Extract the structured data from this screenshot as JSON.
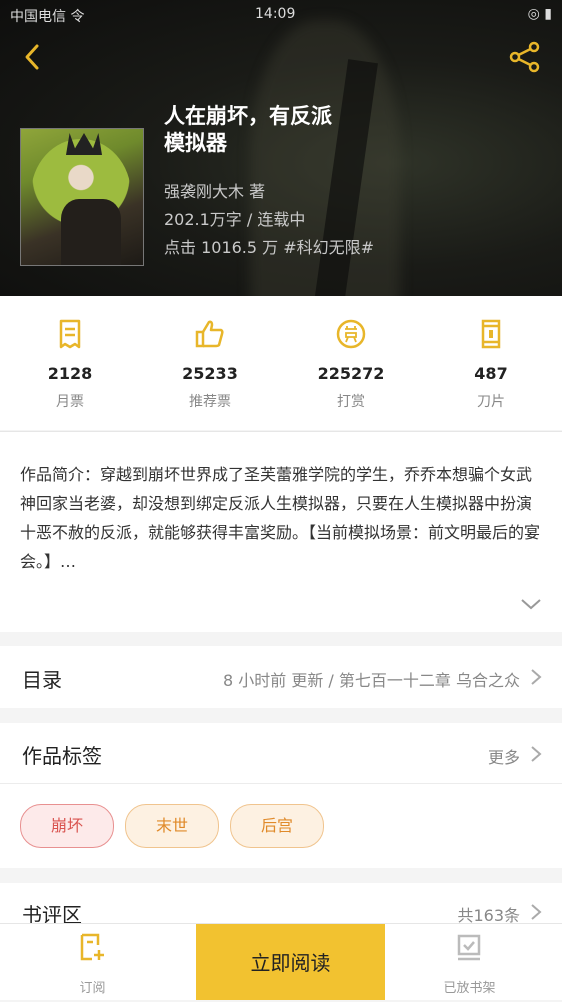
{
  "status_bar": {
    "carrier": "中国电信 令",
    "time": "14:09",
    "battery": "◎ ▮"
  },
  "book": {
    "title_line1": "人在崩坏，有反派",
    "title_line2": "模拟器",
    "author_line": "强袭刚大木  著",
    "words_line": "202.1万字 / 连载中",
    "clicks_line": "点击 1016.5 万  #科幻无限#"
  },
  "stats": [
    {
      "icon": "monthly-ticket-icon",
      "value": "2128",
      "label": "月票"
    },
    {
      "icon": "thumbs-up-icon",
      "value": "25233",
      "label": "推荐票"
    },
    {
      "icon": "reward-icon",
      "value": "225272",
      "label": "打赏"
    },
    {
      "icon": "blade-icon",
      "value": "487",
      "label": "刀片"
    }
  ],
  "intro": {
    "text": "作品简介：穿越到崩坏世界成了圣芙蕾雅学院的学生，乔乔本想骗个女武神回家当老婆，却没想到绑定反派人生模拟器，只要在人生模拟器中扮演十恶不赦的反派，就能够获得丰富奖励。【当前模拟场景：前文明最后的宴会。】…"
  },
  "toc": {
    "label": "目录",
    "update": "8 小时前 更新 / 第七百一十二章 乌合之众"
  },
  "tags_section": {
    "label": "作品标签",
    "more": "更多",
    "tags": [
      "崩坏",
      "末世",
      "后宫"
    ]
  },
  "reviews": {
    "label": "书评区",
    "count": "共163条"
  },
  "bottom_bar": {
    "subscribe": "订阅",
    "read_now": "立即阅读",
    "shelved": "已放书架"
  },
  "colors": {
    "accent": "#f2c230",
    "icon_gold": "#e8b62a"
  }
}
